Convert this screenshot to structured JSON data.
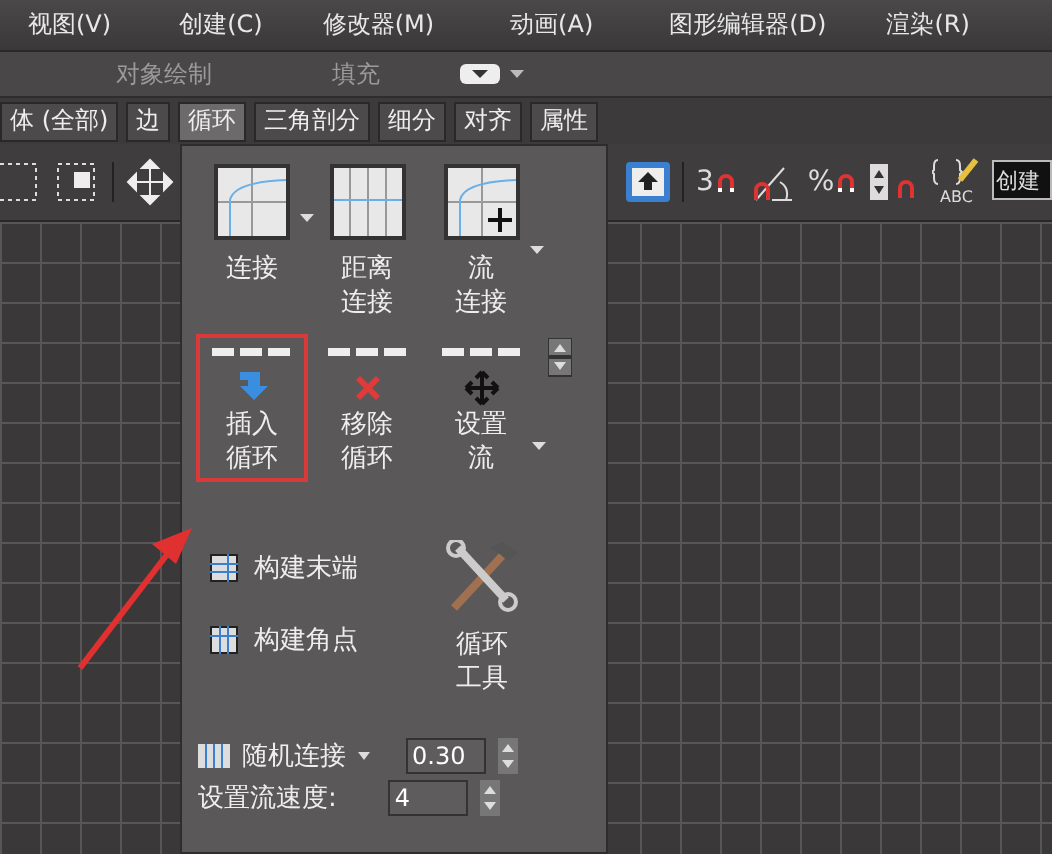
{
  "menu": [
    "视图(V)",
    "创建(C)",
    "修改器(M)",
    "动画(A)",
    "图形编辑器(D)",
    "渲染(R)"
  ],
  "ribbon": {
    "items": [
      "对象绘制",
      "填充"
    ]
  },
  "tabs": [
    {
      "label": "体 (全部)",
      "selected": false
    },
    {
      "label": "边",
      "selected": false
    },
    {
      "label": "循环",
      "selected": true
    },
    {
      "label": "三角剖分",
      "selected": false
    },
    {
      "label": "细分",
      "selected": false
    },
    {
      "label": "对齐",
      "selected": false
    },
    {
      "label": "属性",
      "selected": false
    }
  ],
  "toolbar": [
    {
      "kind": "snap",
      "label": "3"
    },
    {
      "kind": "angle"
    },
    {
      "kind": "percent",
      "label": "%"
    },
    {
      "kind": "spinner"
    },
    {
      "kind": "edit",
      "label": "ABC"
    }
  ],
  "named_set": {
    "value": "创建"
  },
  "panel": {
    "connect": [
      {
        "kind": "connect",
        "lines": [
          "连接"
        ],
        "dropdown": true
      },
      {
        "kind": "distance",
        "lines": [
          "距离",
          "连接"
        ],
        "dropdown": false
      },
      {
        "kind": "flow",
        "lines": [
          "流",
          "连接"
        ],
        "dropdown": true
      }
    ],
    "loops": [
      {
        "kind": "insert",
        "lines": [
          "插入",
          "循环"
        ],
        "dropdown": false,
        "highlighted": true
      },
      {
        "kind": "remove",
        "lines": [
          "移除",
          "循环"
        ],
        "dropdown": false,
        "highlighted": false
      },
      {
        "kind": "flow",
        "lines": [
          "设置",
          "流"
        ],
        "dropdown": true,
        "highlighted": false
      }
    ],
    "build": [
      {
        "kind": "end",
        "label": "构建末端"
      },
      {
        "kind": "corner",
        "label": "构建角点"
      }
    ],
    "loop_tools": {
      "lines": [
        "循环",
        "工具"
      ]
    },
    "random_connect": {
      "label": "随机连接",
      "value": "0.30"
    },
    "flow_speed": {
      "label": "设置流速度:",
      "value": "4"
    }
  },
  "annotation_arrow": true
}
